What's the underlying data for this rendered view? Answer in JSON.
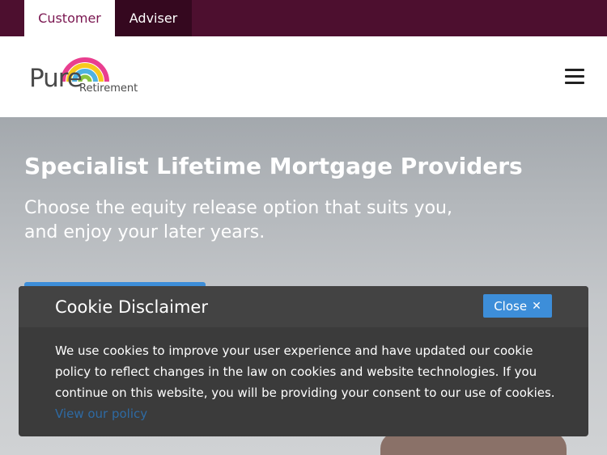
{
  "top_tabs": {
    "customer": "Customer",
    "adviser": "Adviser"
  },
  "logo": {
    "word": "Pure",
    "sub": "Retirement",
    "arc_colors": [
      "#e93e8f",
      "#f7c81d",
      "#4fb2e3",
      "#8ac43f"
    ]
  },
  "menu": {
    "icon": "hamburger-menu-icon"
  },
  "hero": {
    "title": "Specialist Lifetime Mortgage Providers",
    "subtitle": "Choose the equity release option that suits you, and enjoy your later years."
  },
  "cookie": {
    "title": "Cookie Disclaimer",
    "close_label": "Close",
    "close_icon": "close-icon",
    "body": "We use cookies to improve your user experience and have updated our cookie policy to reflect changes in the law on cookies and website technologies. If you continue on this website, you will be providing your consent to our use of cookies.",
    "link": "View our policy"
  },
  "colors": {
    "brand_dark": "#4d0f2f",
    "brand_tab_text": "#7a1650",
    "accent_blue": "#3d8ed9",
    "overlay": "#3b3b3b"
  }
}
